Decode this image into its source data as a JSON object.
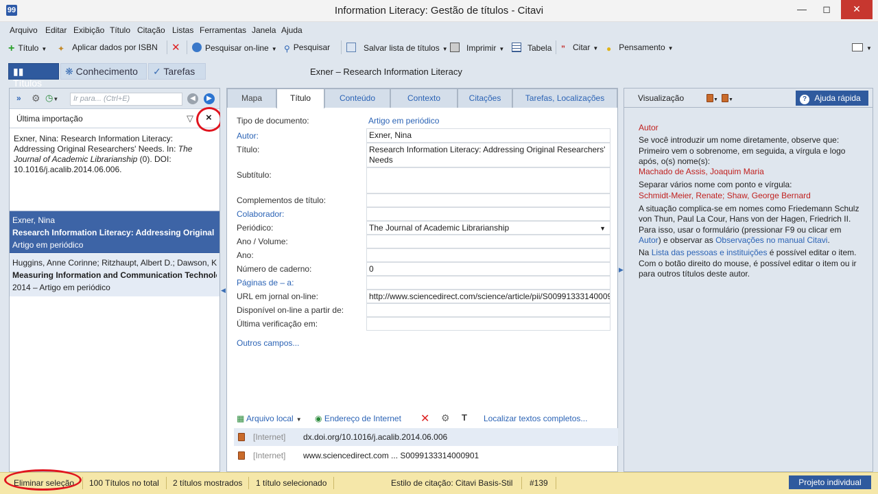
{
  "window": {
    "title": "Information Literacy: Gestão de títulos - Citavi",
    "app_icon": "99"
  },
  "menu": [
    "Arquivo",
    "Editar",
    "Exibição",
    "Título",
    "Citação",
    "Listas",
    "Ferramentas",
    "Janela",
    "Ajuda"
  ],
  "toolbar": {
    "titulo": "Título",
    "aplicar_isbn": "Aplicar dados por ISBN",
    "pesquisar_online": "Pesquisar on-line",
    "pesquisar": "Pesquisar",
    "salvar_lista": "Salvar lista de títulos",
    "imprimir": "Imprimir",
    "tabela": "Tabela",
    "citar": "Citar",
    "pensamento": "Pensamento"
  },
  "nav": {
    "titulos": "Títulos",
    "conhecimento": "Conhecimento",
    "tarefas": "Tarefas"
  },
  "current_reference": "Exner – Research Information Literacy",
  "left": {
    "search_placeholder": "Ir para... (Ctrl+E)",
    "filter_label": "Última importação",
    "filter_clear": "×",
    "preview": {
      "line1": "Exner, Nina: Research Information Literacy: Addressing Original Researchers' Needs. In: ",
      "journal": "The Journal of Academic Librarianship",
      "line2": " (0). DOI: 10.1016/j.acalib.2014.06.006."
    },
    "items": [
      {
        "authors": "Exner, Nina",
        "title": "Research Information Literacy: Addressing Original Re",
        "meta": "Artigo em periódico"
      },
      {
        "authors": "Huggins, Anne Corinne; Ritzhaupt, Albert D.; Dawson, K",
        "title": "Measuring Information and Communication Technolo",
        "meta": "2014 – Artigo em periódico"
      }
    ]
  },
  "tabs": [
    "Mapa",
    "Título",
    "Conteúdo",
    "Contexto",
    "Citações",
    "Tarefas, Localizações"
  ],
  "fields": {
    "doc_type_label": "Tipo de documento:",
    "doc_type_value": "Artigo em periódico",
    "autor_label": "Autor:",
    "autor_value": "Exner, Nina",
    "titulo_label": "Título:",
    "titulo_value_1": "Research Information Literacy: Addressing Original Researchers'",
    "titulo_value_2": "Needs",
    "subtitulo_label": "Subtítulo:",
    "complementos_label": "Complementos de título:",
    "colaborador_label": "Colaborador:",
    "periodico_label": "Periódico:",
    "periodico_value": "The Journal of Academic Librarianship",
    "ano_volume_label": "Ano / Volume:",
    "ano_label": "Ano:",
    "caderno_label": "Número de caderno:",
    "caderno_value": "0",
    "paginas_label": "Páginas de – a:",
    "url_label": "URL em jornal on-line:",
    "url_value": "http://www.sciencedirect.com/science/article/pii/S00991333140009",
    "disponivel_label": "Disponível on-line a partir de:",
    "verificacao_label": "Última verificação em:",
    "outros": "Outros campos..."
  },
  "attachments": {
    "arquivo_local": "Arquivo local",
    "endereco": "Endereço de Internet",
    "localizar": "Localizar textos completos...",
    "rows": [
      {
        "tag": "[Internet]",
        "value": "dx.doi.org/10.1016/j.acalib.2014.06.006"
      },
      {
        "tag": "[Internet]",
        "value": "www.sciencedirect.com ... S0099133314000901"
      }
    ]
  },
  "right": {
    "visualizacao": "Visualização",
    "ajuda": "Ajuda rápida",
    "help": {
      "heading": "Autor",
      "p1": "Se você introduzir um nome diretamente, observe que: Primeiro vem o sobrenome, em seguida, a vírgula e logo após, o(s) nome(s):",
      "ex1": "Machado de Assis, Joaquim Maria",
      "p2": "Separar vários nome com ponto e vírgula:",
      "ex2": "Schmidt-Meier, Renate; Shaw, George Bernard",
      "p3a": "A situação complica-se em nomes como Friedemann Schulz von Thun, Paul La Cour, Hans von der Hagen, Friedrich II. Para isso, usar o formulário (pressionar F9 ou clicar em ",
      "p3link1": "Autor",
      "p3b": ") e observar as ",
      "p3link2": "Observações no manual Citavi",
      "p3c": ".",
      "p4a": "Na ",
      "p4link": "Lista das pessoas e instituições",
      "p4b": "  é possível editar o item. Com o botão direito do mouse, é possível editar o item ou ir para outros títulos deste autor."
    }
  },
  "status": {
    "eliminar": "Eliminar seleção",
    "total": "100 Títulos no total",
    "mostrados": "2 títulos mostrados",
    "selecionado": "1 título selecionado",
    "estilo": "Estilo de citação: Citavi Basis-Stil",
    "numero": "#139",
    "projeto": "Projeto individual"
  },
  "colors": {
    "accent": "#2f5a9e",
    "highlight_circle": "#e0141e",
    "status_bg": "#f5e7a9"
  }
}
